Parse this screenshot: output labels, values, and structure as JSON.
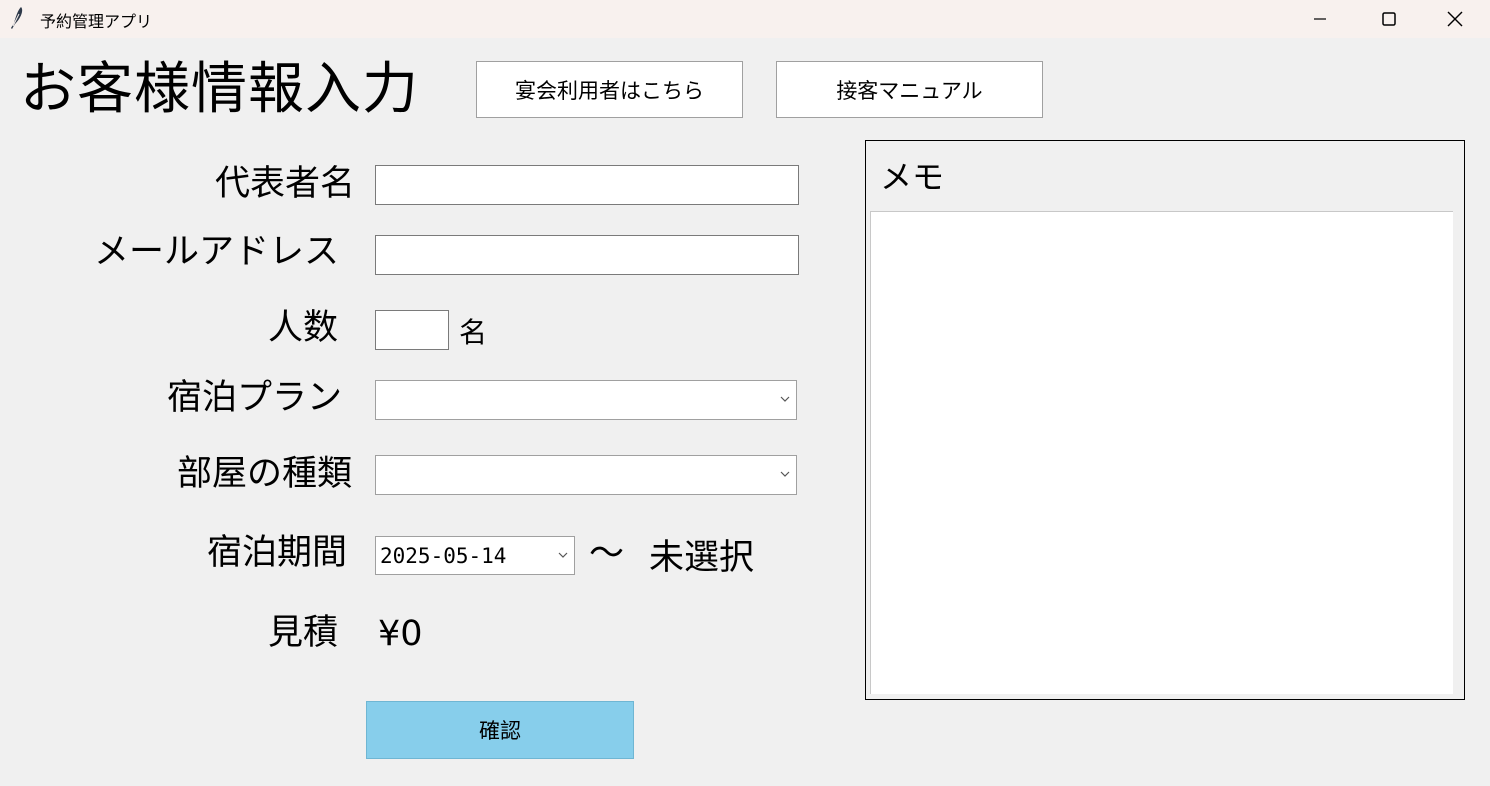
{
  "window": {
    "title": "予約管理アプリ",
    "icon": "feather-icon"
  },
  "header": {
    "title": "お客様情報入力",
    "banquet_button": "宴会利用者はこちら",
    "manual_button": "接客マニュアル"
  },
  "form": {
    "representative_label": "代表者名",
    "representative_value": "",
    "email_label": "メールアドレス",
    "email_value": "",
    "guests_label": "人数",
    "guests_value": "",
    "guests_unit": "名",
    "plan_label": "宿泊プラン",
    "plan_value": "",
    "room_label": "部屋の種類",
    "room_value": "",
    "period_label": "宿泊期間",
    "period_start": "2025-05-14",
    "period_separator": "〜",
    "period_end": "未選択",
    "estimate_label": "見積",
    "estimate_value": "¥0",
    "confirm_button": "確認"
  },
  "memo": {
    "title": "メモ",
    "content": ""
  },
  "colors": {
    "titlebar": "#f8f1ee",
    "background": "#f0f0f0",
    "confirm_button": "#87ceeb"
  }
}
